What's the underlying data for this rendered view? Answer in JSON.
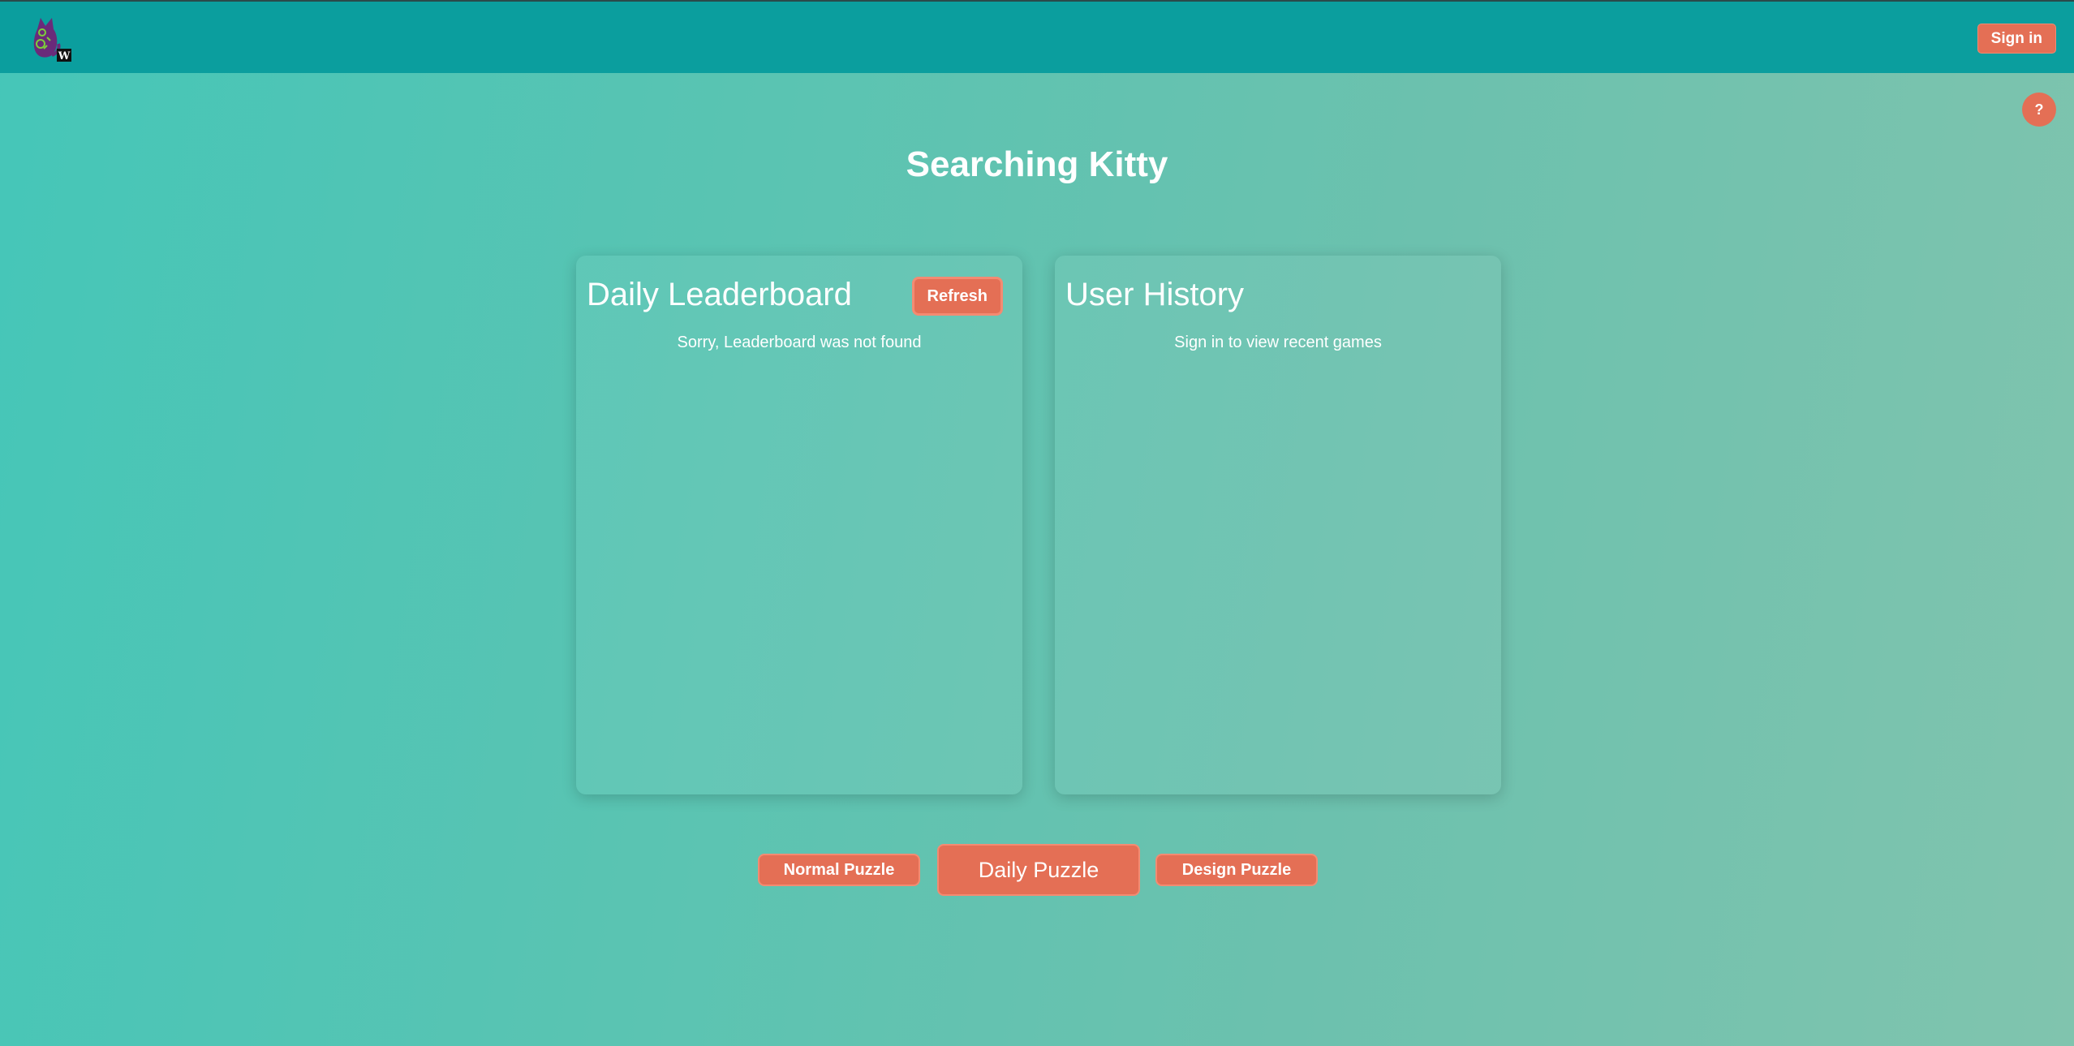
{
  "header": {
    "logo_letter": "W",
    "signin_label": "Sign in"
  },
  "help": {
    "label": "?"
  },
  "page": {
    "title": "Searching Kitty"
  },
  "leaderboard": {
    "title": "Daily Leaderboard",
    "refresh_label": "Refresh",
    "message": "Sorry, Leaderboard was not found"
  },
  "history": {
    "title": "User History",
    "message": "Sign in to view recent games"
  },
  "actions": {
    "normal_label": "Normal Puzzle",
    "daily_label": "Daily Puzzle",
    "design_label": "Design Puzzle"
  },
  "colors": {
    "topbar": "#0b9e9e",
    "accent": "#e46f55",
    "background_start": "#45c6b8",
    "background_end": "#80c4ae"
  }
}
